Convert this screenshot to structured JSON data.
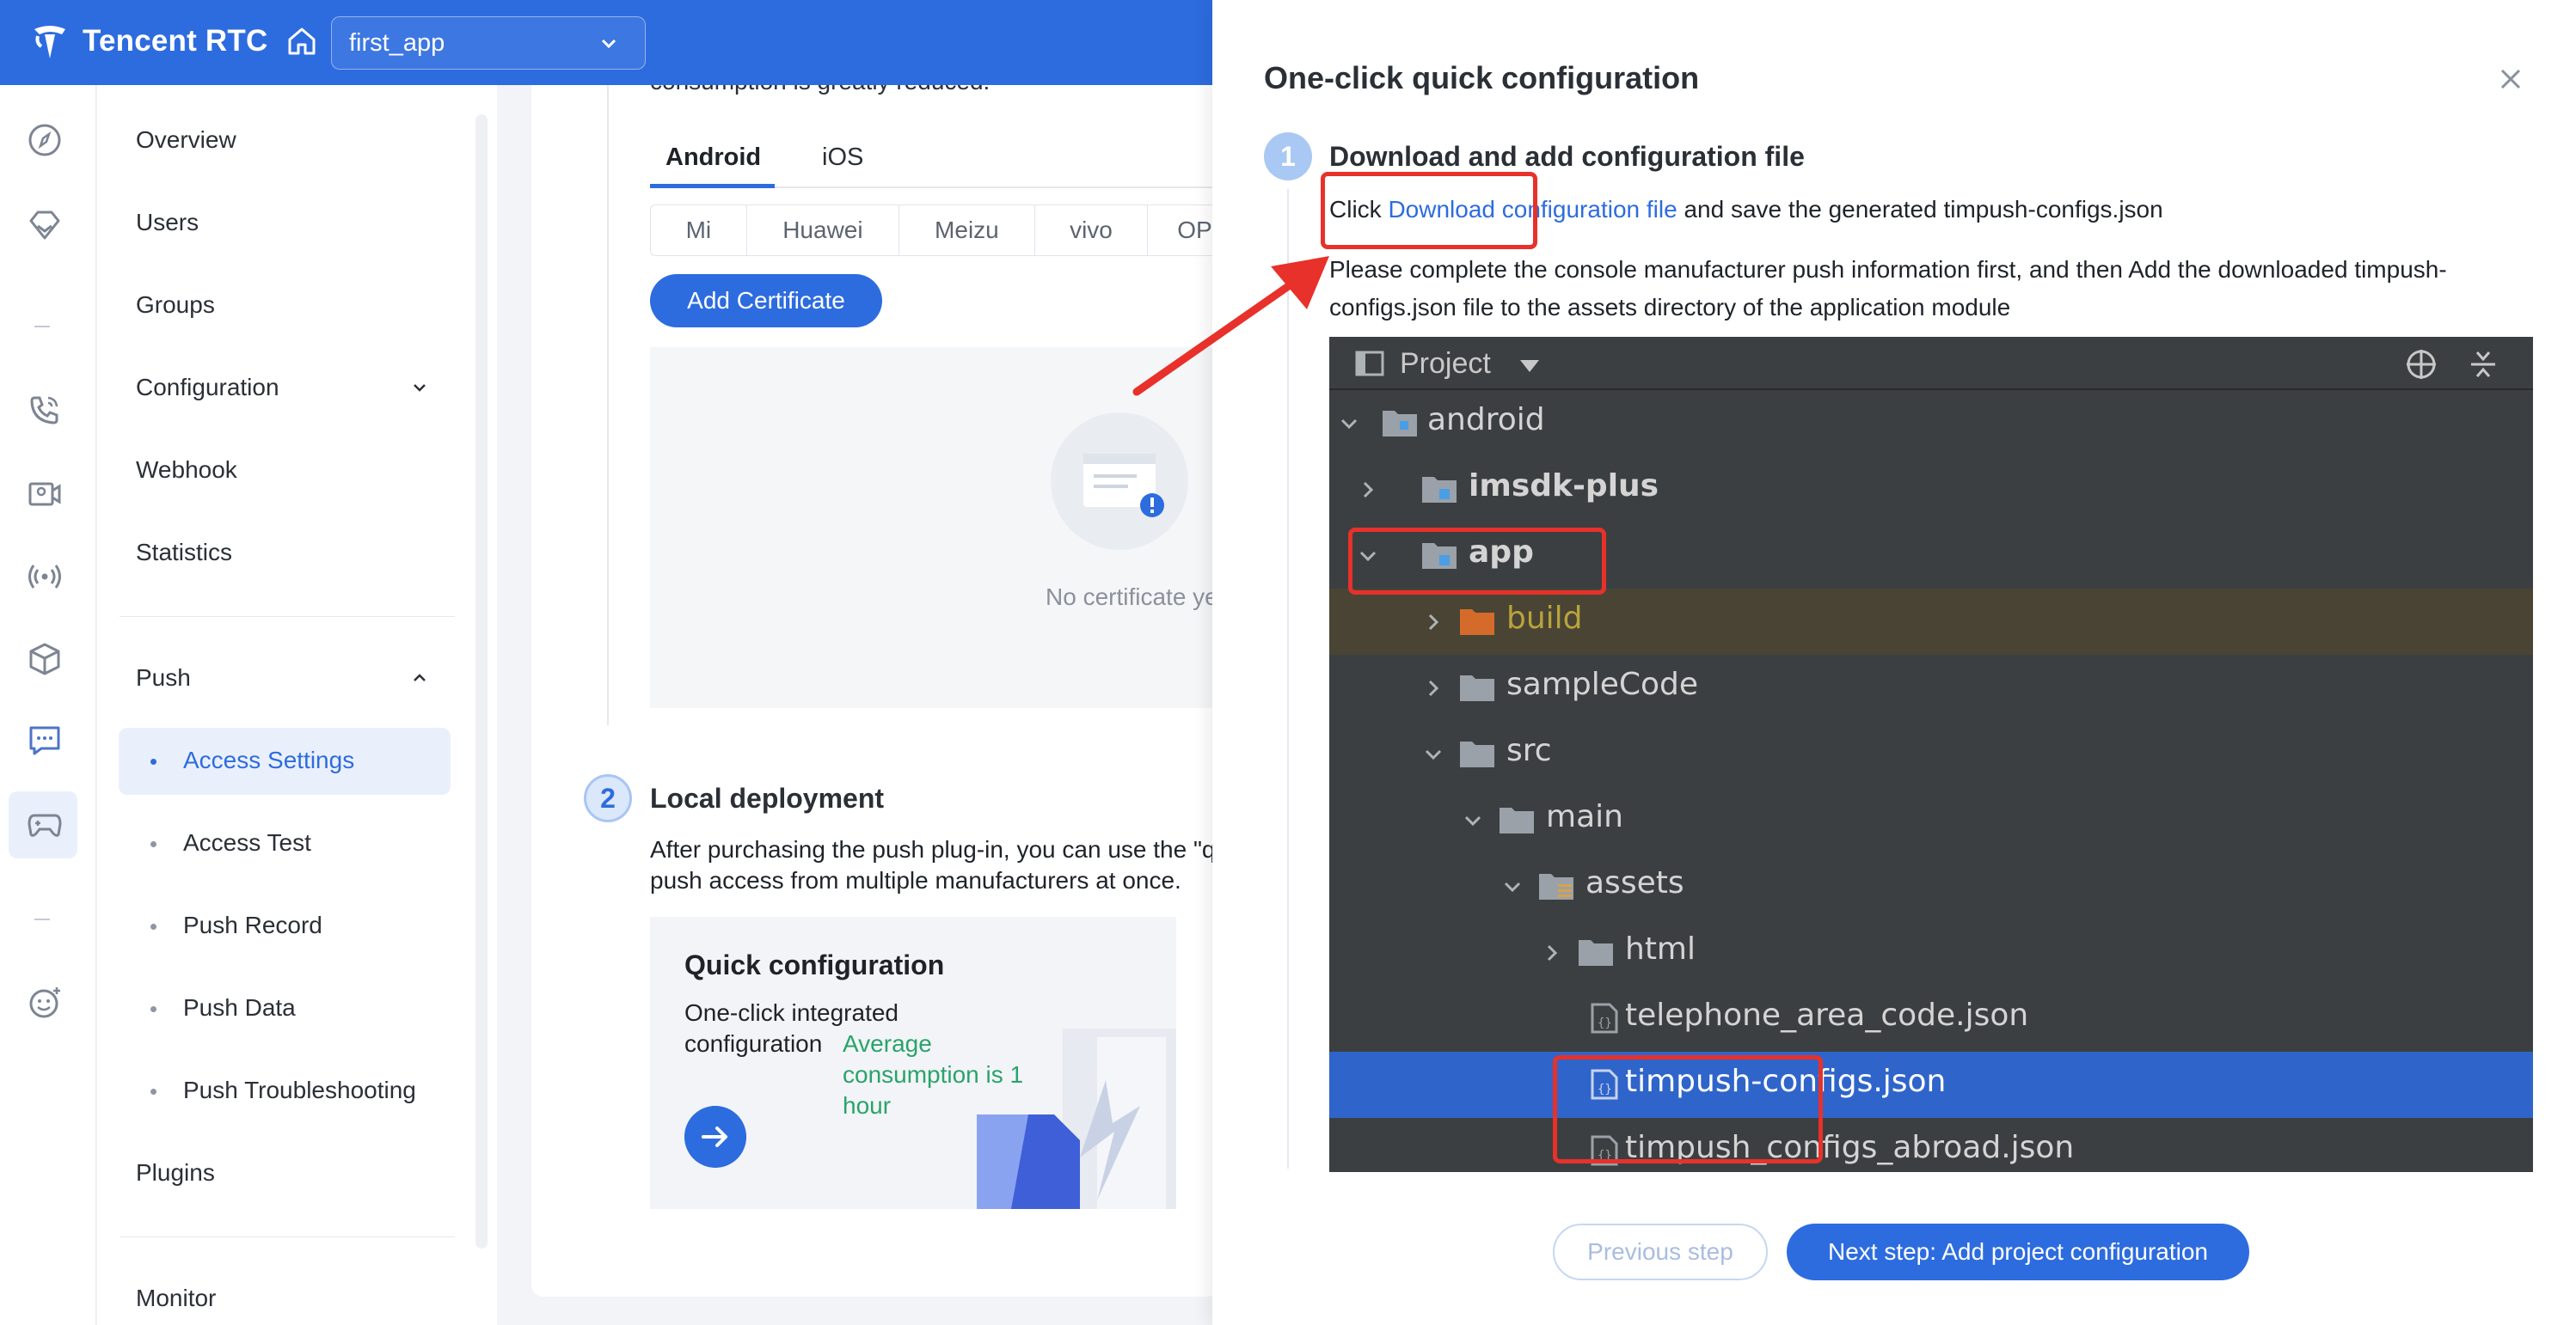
{
  "header": {
    "brand": "Tencent RTC",
    "app_selector": {
      "value": "first_app"
    }
  },
  "sidebar": {
    "items": [
      {
        "label": "Overview"
      },
      {
        "label": "Users"
      },
      {
        "label": "Groups"
      },
      {
        "label": "Configuration"
      },
      {
        "label": "Webhook"
      },
      {
        "label": "Statistics"
      },
      {
        "label": "Push"
      },
      {
        "label": "Plugins"
      },
      {
        "label": "Monitor"
      }
    ],
    "push_subitems": [
      {
        "label": "Access Settings",
        "active": true
      },
      {
        "label": "Access Test"
      },
      {
        "label": "Push Record"
      },
      {
        "label": "Push Data"
      },
      {
        "label": "Push Troubleshooting"
      }
    ]
  },
  "main": {
    "truncated_text": "consumption is greatly reduced.",
    "platform_tabs": [
      "Android",
      "iOS"
    ],
    "vendor_tabs": [
      "Mi",
      "Huawei",
      "Meizu",
      "vivo",
      "OP"
    ],
    "add_certificate_label": "Add Certificate",
    "empty_text": "No certificate yet",
    "step2": {
      "number": "2",
      "title": "Local deployment",
      "desc_line1": "After purchasing the push plug-in, you can use the \"q",
      "desc_line2": "push access from multiple manufacturers at once."
    },
    "quick_card": {
      "title": "Quick configuration",
      "desc": "One-click integrated configuration",
      "highlight": "Average consumption is 1 hour"
    }
  },
  "drawer": {
    "title": "One-click quick configuration",
    "step1": {
      "number": "1",
      "title": "Download and add configuration file",
      "click_prefix": "Click ",
      "download_link": "Download configuration file",
      "click_suffix": " and save the generated timpush-configs.json",
      "desc": "Please complete the console manufacturer push information first, and then Add the downloaded timpush-configs.json file to the assets directory of the application module"
    },
    "ide": {
      "panel_title": "Project",
      "tree": [
        {
          "label": "android"
        },
        {
          "label": "imsdk-plus"
        },
        {
          "label": "app"
        },
        {
          "label": "build"
        },
        {
          "label": "sampleCode"
        },
        {
          "label": "src"
        },
        {
          "label": "main"
        },
        {
          "label": "assets"
        },
        {
          "label": "html"
        },
        {
          "label": "telephone_area_code.json"
        },
        {
          "label": "timpush-configs.json"
        },
        {
          "label": "timpush_configs_abroad.json"
        }
      ]
    },
    "prev_label": "Previous step",
    "next_label": "Next step: Add project configuration"
  },
  "colors": {
    "brand_blue": "#2d6cdf",
    "annotation_red": "#e8312a",
    "ide_bg": "#3c3f41",
    "ide_selected": "#2f65ca",
    "success_green": "#2aa36b"
  }
}
